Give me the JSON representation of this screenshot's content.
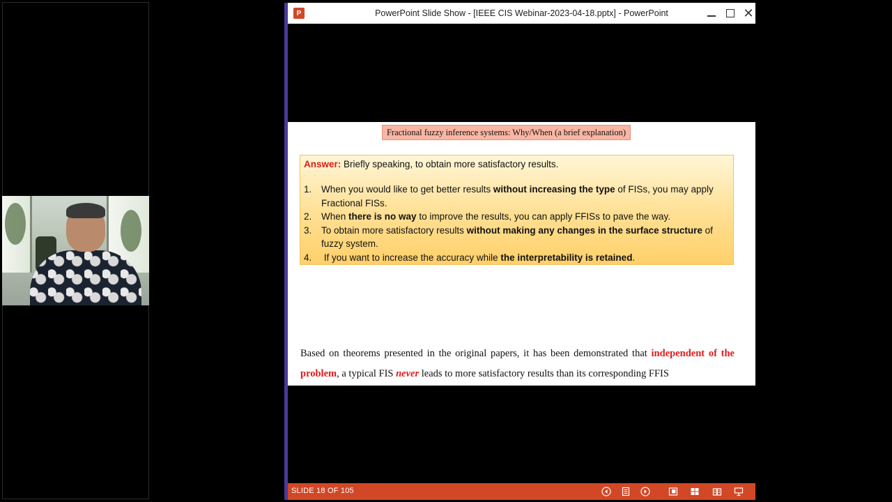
{
  "window": {
    "title": "PowerPoint Slide Show - [IEEE CIS Webinar-2023-04-18.pptx] - PowerPoint",
    "app_icon": "P"
  },
  "slide": {
    "title": "Fractional fuzzy inference systems: Why/When (a brief explanation)",
    "answer_label": "Answer:",
    "answer_text": "Briefly speaking, to obtain more satisfactory results.",
    "points": [
      {
        "num": "1.",
        "pre": "When you would like to get better results ",
        "bold": "without increasing the type",
        "post": " of FISs, you may apply Fractional FISs."
      },
      {
        "num": "2.",
        "pre": "When ",
        "bold": "there is no way",
        "post": " to improve the results, you can apply FFISs to pave the way."
      },
      {
        "num": "3.",
        "pre": "To obtain more satisfactory results ",
        "bold": "without making any changes in the surface structure",
        "post": " of fuzzy system."
      },
      {
        "num": "4.",
        "pre": " If you want to increase the accuracy while ",
        "bold": "the interpretability is retained",
        "post": "."
      }
    ],
    "paragraph": {
      "part1": "Based on theorems presented in the original papers, it has been demonstrated that ",
      "highlight": "independent of the problem",
      "part2": ", a typical FIS ",
      "emphasis": "never",
      "part3": " leads to more satisfactory results than its corresponding FFIS"
    }
  },
  "statusbar": {
    "slide_counter": "SLIDE 18 OF 105",
    "buttons": [
      "previous-icon",
      "slide-menu-icon",
      "next-icon",
      "normal-view-icon",
      "slide-sorter-icon",
      "reading-view-icon",
      "slide-show-icon"
    ]
  },
  "colors": {
    "statusbar": "#d24726",
    "accent_red": "#e01b1b",
    "title_box": "#f8b6a3",
    "answer_box": "#ffdf92"
  }
}
